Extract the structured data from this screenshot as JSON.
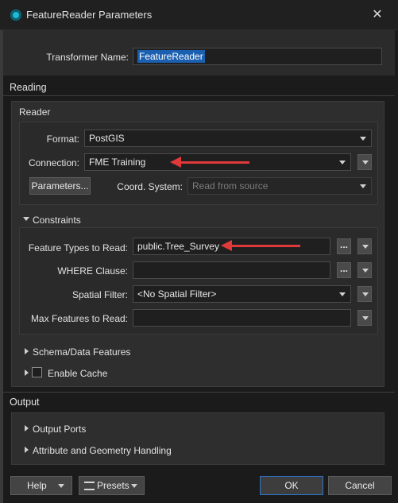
{
  "window": {
    "title": "FeatureReader Parameters"
  },
  "transformer": {
    "label": "Transformer Name:",
    "value": "FeatureReader"
  },
  "reading": {
    "section_label": "Reading",
    "reader_label": "Reader",
    "format": {
      "label": "Format:",
      "value": "PostGIS"
    },
    "connection": {
      "label": "Connection:",
      "value": "FME Training"
    },
    "parameters_button": "Parameters...",
    "coord_system": {
      "label": "Coord. System:",
      "placeholder": "Read from source"
    }
  },
  "constraints": {
    "label": "Constraints",
    "feature_types": {
      "label": "Feature Types to Read:",
      "value": "public.Tree_Survey"
    },
    "where_clause": {
      "label": "WHERE Clause:",
      "value": ""
    },
    "spatial_filter": {
      "label": "Spatial Filter:",
      "value": "<No Spatial Filter>"
    },
    "max_features": {
      "label": "Max Features to Read:",
      "value": ""
    }
  },
  "schema_features": {
    "label": "Schema/Data Features"
  },
  "enable_cache": {
    "label": "Enable Cache",
    "checked": false
  },
  "output": {
    "section_label": "Output",
    "output_ports": "Output Ports",
    "attr_geom": "Attribute and Geometry Handling"
  },
  "footer": {
    "help": "Help",
    "presets": "Presets",
    "ok": "OK",
    "cancel": "Cancel"
  },
  "ellipsis": "...",
  "icons": {
    "app": "fme-app-icon",
    "close": "close-icon"
  },
  "colors": {
    "accent": "#1b5fb0",
    "annotation_arrow": "#e0393a",
    "ok_border": "#2f74c8"
  }
}
